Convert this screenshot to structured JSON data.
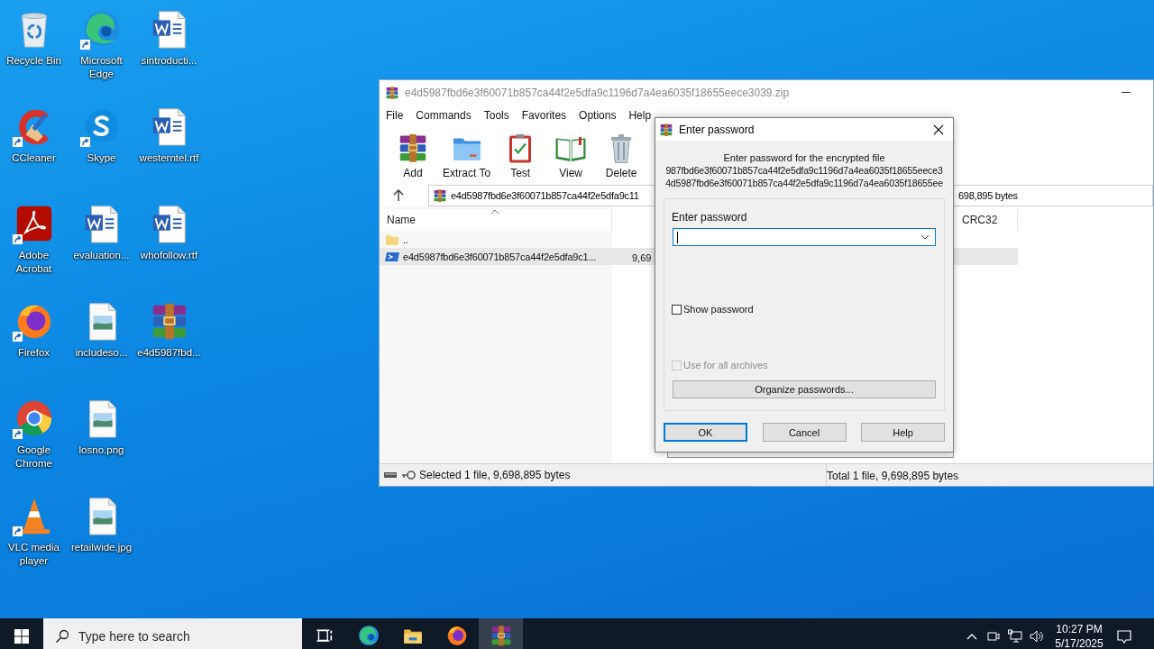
{
  "desktop_icons": [
    {
      "label": "Recycle Bin",
      "kind": "recycle",
      "shortcut": false
    },
    {
      "label": "CCleaner",
      "kind": "ccleaner",
      "shortcut": true
    },
    {
      "label": "Adobe Acrobat",
      "kind": "acrobat",
      "shortcut": true
    },
    {
      "label": "Firefox",
      "kind": "firefox",
      "shortcut": true
    },
    {
      "label": "Google Chrome",
      "kind": "chrome",
      "shortcut": true
    },
    {
      "label": "VLC media player",
      "kind": "vlc",
      "shortcut": true
    },
    {
      "label": "Microsoft Edge",
      "kind": "edge",
      "shortcut": true
    },
    {
      "label": "Skype",
      "kind": "skype",
      "shortcut": true
    },
    {
      "label": "evaluation...",
      "kind": "word",
      "shortcut": false
    },
    {
      "label": "includeso...",
      "kind": "image",
      "shortcut": false
    },
    {
      "label": "losno.png",
      "kind": "image",
      "shortcut": false
    },
    {
      "label": "retailwide.jpg",
      "kind": "image",
      "shortcut": false
    },
    {
      "label": "sintroducti...",
      "kind": "word",
      "shortcut": false
    },
    {
      "label": "westerntel.rtf",
      "kind": "word",
      "shortcut": false
    },
    {
      "label": "whofollow.rtf",
      "kind": "word",
      "shortcut": false
    },
    {
      "label": "e4d5987fbd...",
      "kind": "winrar",
      "shortcut": false
    }
  ],
  "archive_window": {
    "title": "e4d5987fbd6e3f60071b857ca44f2e5dfa9c1196d7a4ea6035f18655eece3039.zip",
    "menu": [
      "File",
      "Commands",
      "Tools",
      "Favorites",
      "Options",
      "Help"
    ],
    "toolbar": [
      {
        "label": "Add",
        "kind": "add"
      },
      {
        "label": "Extract To",
        "kind": "extract"
      },
      {
        "label": "Test",
        "kind": "test"
      },
      {
        "label": "View",
        "kind": "view"
      },
      {
        "label": "Delete",
        "kind": "delete"
      }
    ],
    "address": {
      "path": "e4d5987fbd6e3f60071b857ca44f2e5dfa9c11",
      "tail": "698,895 bytes"
    },
    "columns": [
      {
        "label": "Name"
      },
      {
        "label": "CRC32"
      }
    ],
    "rows": [
      {
        "name": "..",
        "kind": "folder",
        "selected": false
      },
      {
        "name": "e4d5987fbd6e3f60071b857ca44f2e5dfa9c1...",
        "kind": "script",
        "size": "9,69",
        "selected": true
      }
    ],
    "status": {
      "left": "Selected 1 file, 9,698,895 bytes",
      "right": "Total 1 file, 9,698,895 bytes"
    }
  },
  "password_dialog": {
    "title": "Enter password",
    "heading": "Enter password for the encrypted file",
    "file_lines": [
      "987fbd6e3f60071b857ca44f2e5dfa9c1196d7a4ea6035f18655eece3",
      "4d5987fbd6e3f60071b857ca44f2e5dfa9c1196d7a4ea6035f18655ee"
    ],
    "field_label": "Enter password",
    "show_password": {
      "label": "Show password",
      "checked": false
    },
    "use_for_all": {
      "label": "Use for all archives",
      "checked": false,
      "disabled": true
    },
    "organize_button": "Organize passwords...",
    "buttons": [
      {
        "label": "OK",
        "default": true
      },
      {
        "label": "Cancel",
        "default": false
      },
      {
        "label": "Help",
        "default": false
      }
    ]
  },
  "taskbar": {
    "search_placeholder": "Type here to search",
    "apps": [
      {
        "kind": "taskview",
        "active": false
      },
      {
        "kind": "edge",
        "active": false
      },
      {
        "kind": "explorer",
        "active": false
      },
      {
        "kind": "firefox",
        "active": false
      },
      {
        "kind": "winrar",
        "active": true
      }
    ],
    "time": "10:27 PM",
    "date": "5/17/2025"
  }
}
